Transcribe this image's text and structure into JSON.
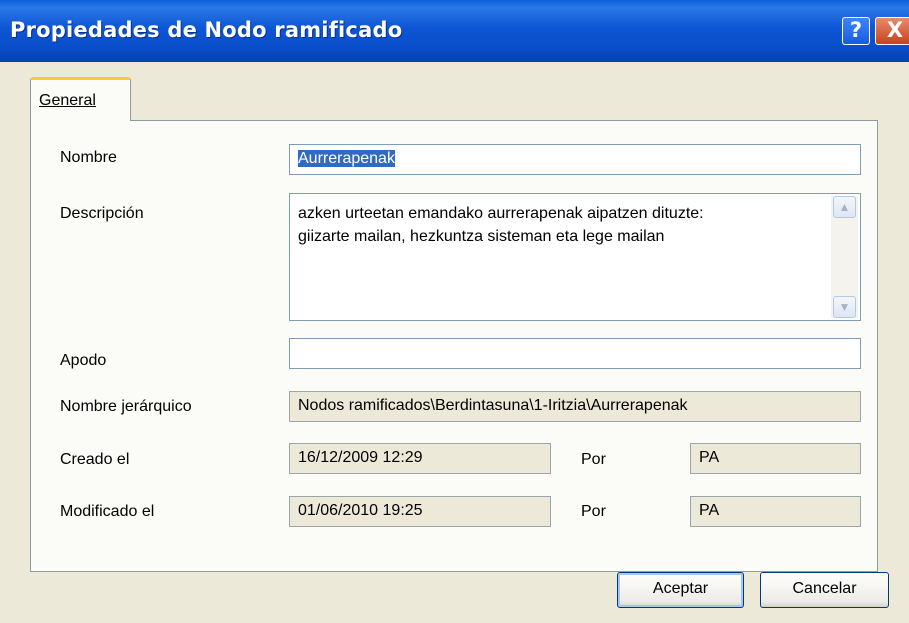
{
  "window": {
    "title": "Propiedades de Nodo ramificado",
    "help_glyph": "?",
    "close_glyph": "X",
    "colors": {
      "title_bar": "#0a4cc8",
      "background": "#ece9d8",
      "tab_highlight": "#ffc83c",
      "selection": "#316ac5"
    }
  },
  "tabs": [
    {
      "label": "General",
      "active": true
    }
  ],
  "form": {
    "nombre": {
      "label": "Nombre",
      "value": "Aurrerapenak"
    },
    "descripcion": {
      "label": "Descripción",
      "lines": [
        "azken urteetan emandako aurrerapenak aipatzen dituzte:",
        "giizarte mailan, hezkuntza sisteman eta lege mailan"
      ]
    },
    "apodo": {
      "label": "Apodo",
      "value": ""
    },
    "nombre_jerarquico": {
      "label": "Nombre jerárquico",
      "value": "Nodos ramificados\\Berdintasuna\\1-Iritzia\\Aurrerapenak"
    },
    "creado": {
      "label": "Creado el",
      "value": "16/12/2009 12:29",
      "por_label": "Por",
      "por_value": "PA"
    },
    "modificado": {
      "label": "Modificado el",
      "value": "01/06/2010 19:25",
      "por_label": "Por",
      "por_value": "PA"
    }
  },
  "buttons": {
    "ok": "Aceptar",
    "cancel": "Cancelar"
  },
  "icons": {
    "scroll_up": "chevron-up-icon",
    "scroll_down": "chevron-down-icon"
  }
}
